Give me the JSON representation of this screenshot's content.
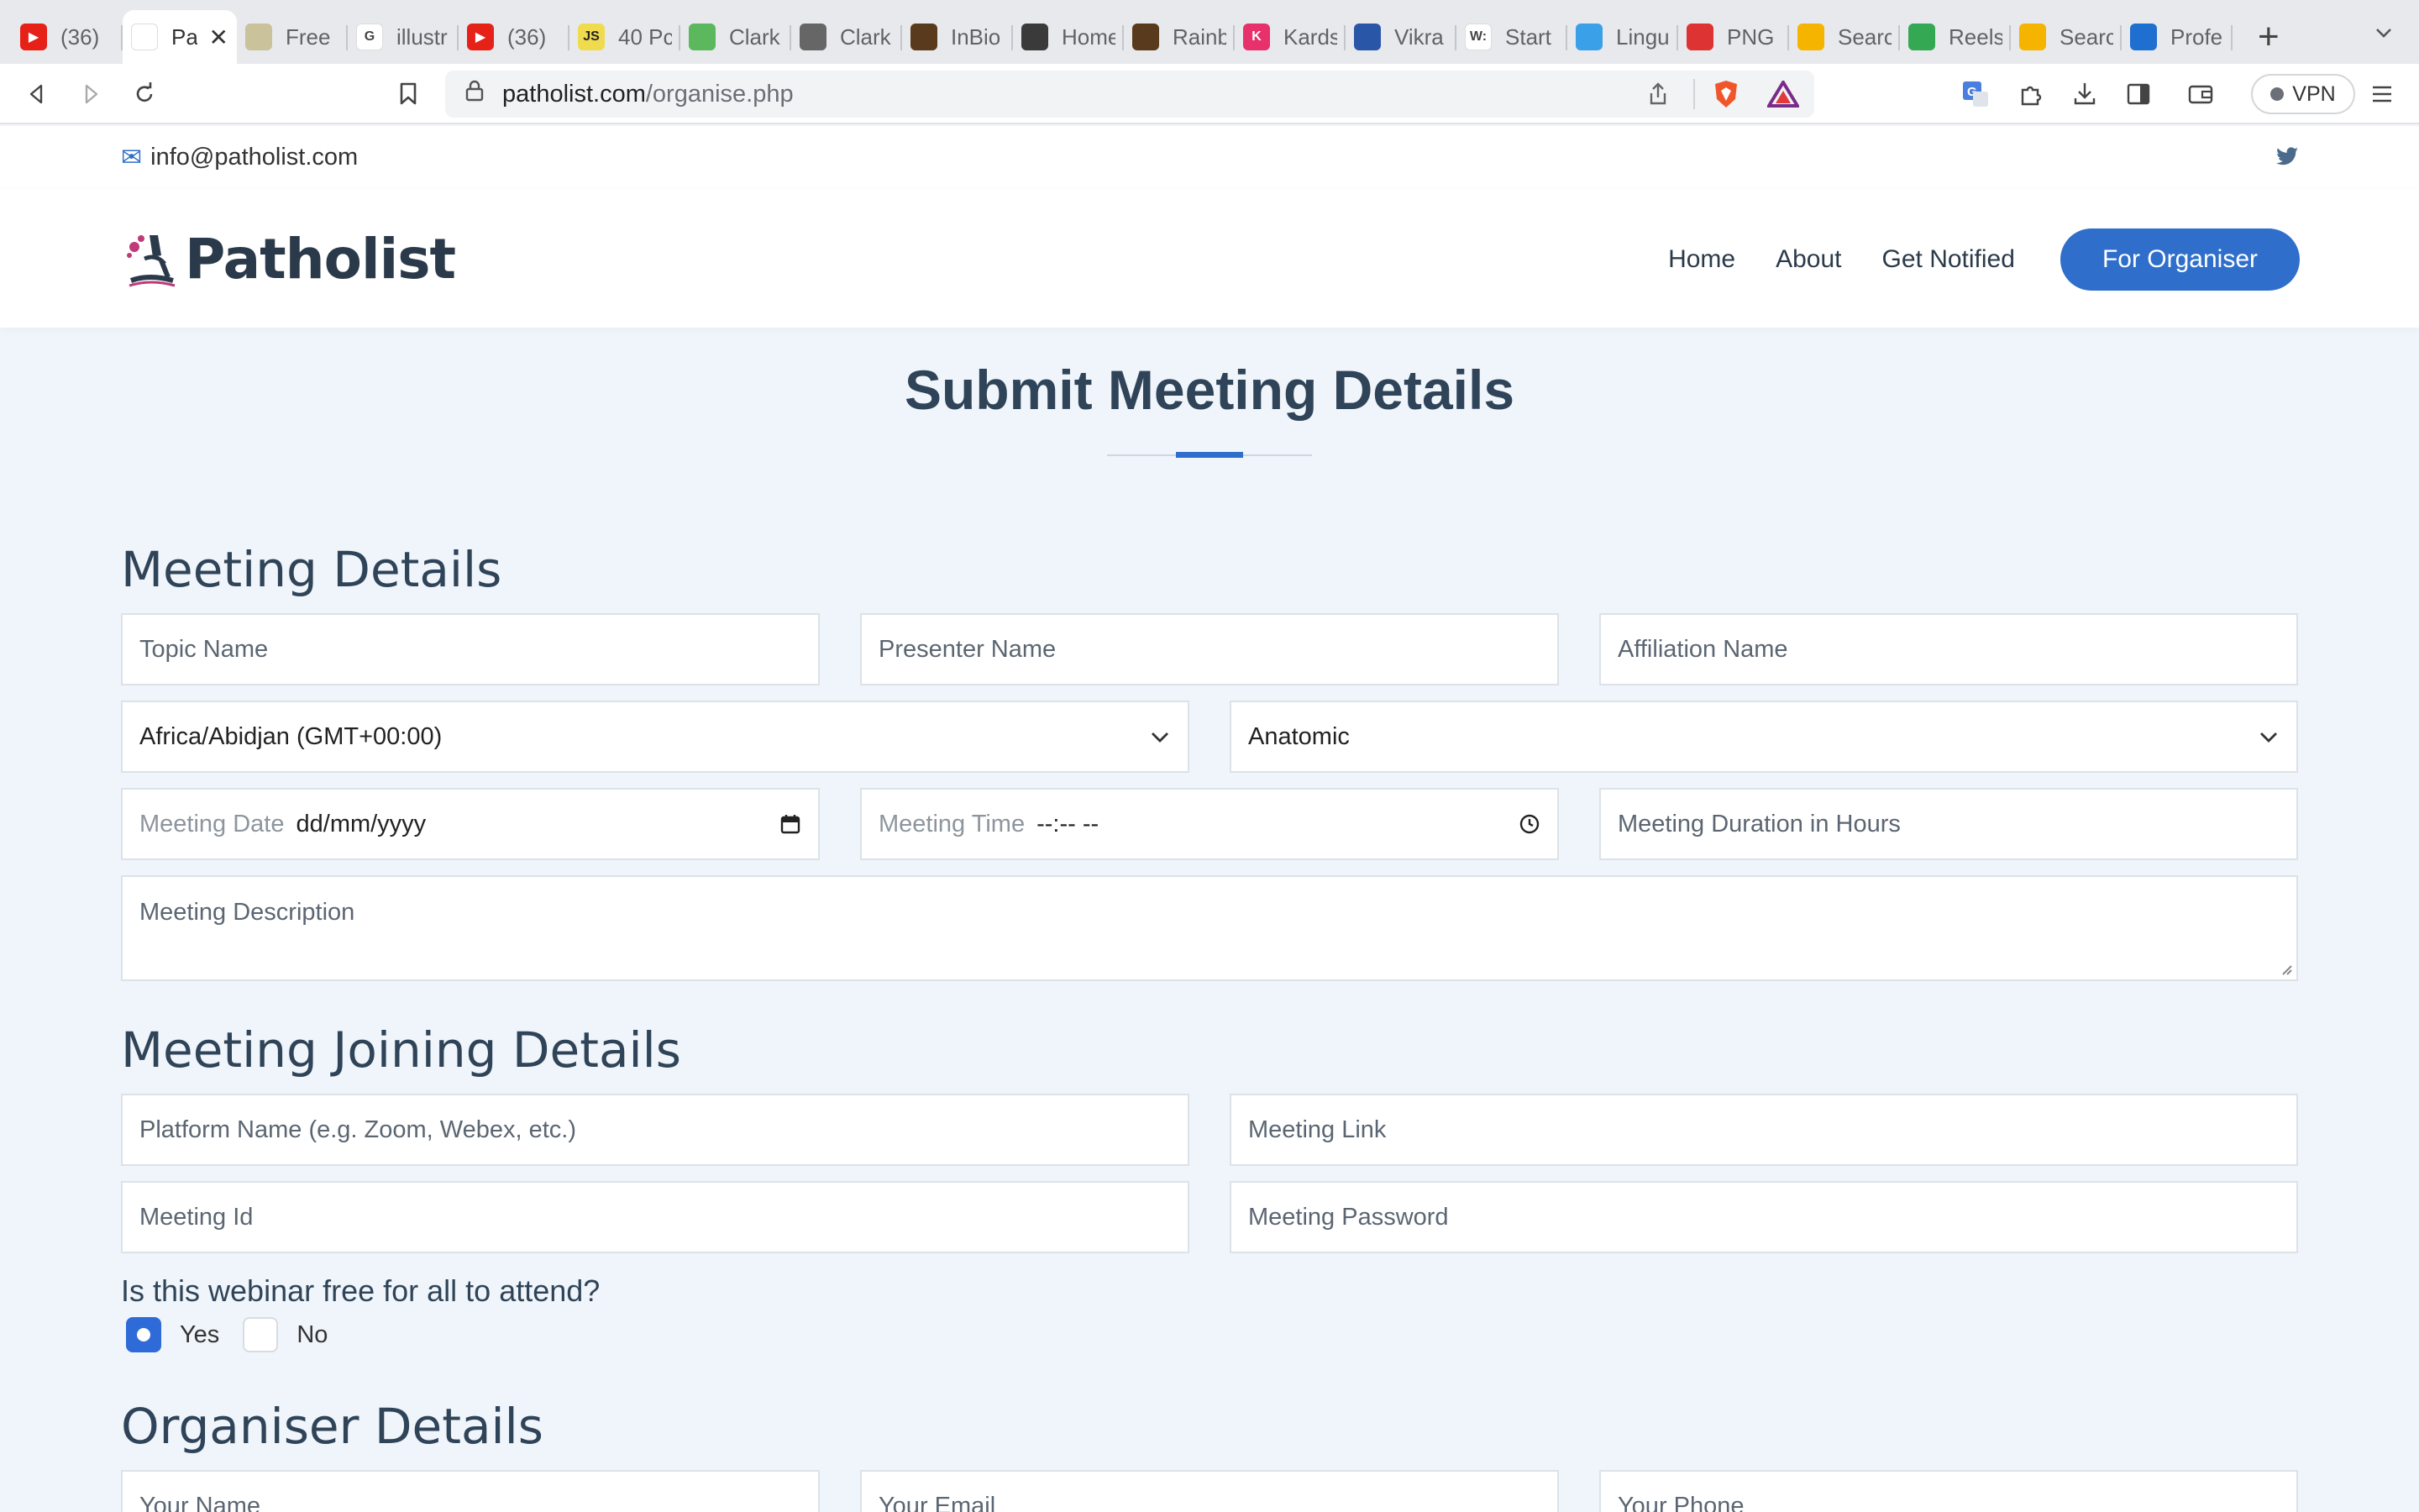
{
  "browser": {
    "tabs": [
      {
        "label": "(36)",
        "icon": "youtube-icon",
        "color": "#e62117",
        "glyph": "▶"
      },
      {
        "label": "Pa",
        "icon": "patholist-favicon-icon",
        "color": "#ffffff",
        "glyph": "",
        "active": true
      },
      {
        "label": "Free",
        "icon": "image-icon",
        "color": "#c9c29a",
        "glyph": ""
      },
      {
        "label": "illustr",
        "icon": "google-icon",
        "color": "#ffffff",
        "glyph": "G"
      },
      {
        "label": "(36)",
        "icon": "youtube-icon",
        "color": "#e62117",
        "glyph": "▶"
      },
      {
        "label": "40 Pc",
        "icon": "js-icon",
        "color": "#f0db4f",
        "glyph": "JS"
      },
      {
        "label": "Clark",
        "icon": "leaf-icon",
        "color": "#5cb85c",
        "glyph": ""
      },
      {
        "label": "Clark",
        "icon": "globe-icon",
        "color": "#666666",
        "glyph": ""
      },
      {
        "label": "InBio",
        "icon": "photo-icon",
        "color": "#5a3a1c",
        "glyph": ""
      },
      {
        "label": "Home",
        "icon": "avatar-icon",
        "color": "#3a3a3a",
        "glyph": ""
      },
      {
        "label": "Rainb",
        "icon": "photo-icon",
        "color": "#5a3a1c",
        "glyph": ""
      },
      {
        "label": "Kards",
        "icon": "k-icon",
        "color": "#e6316a",
        "glyph": "K"
      },
      {
        "label": "Vikra",
        "icon": "person-icon",
        "color": "#2a56a8",
        "glyph": ""
      },
      {
        "label": "Start",
        "icon": "w-icon",
        "color": "#ffffff",
        "glyph": "W:"
      },
      {
        "label": "Lingu",
        "icon": "bird-icon",
        "color": "#3aa0e8",
        "glyph": ""
      },
      {
        "label": "PNG",
        "icon": "cloud-icon",
        "color": "#d33",
        "glyph": ""
      },
      {
        "label": "Searc",
        "icon": "drive-icon",
        "color": "#f4b400",
        "glyph": ""
      },
      {
        "label": "Reels",
        "icon": "play-store-icon",
        "color": "#34a853",
        "glyph": ""
      },
      {
        "label": "Searc",
        "icon": "drive-icon",
        "color": "#f4b400",
        "glyph": ""
      },
      {
        "label": "Profe",
        "icon": "profile-icon",
        "color": "#1e6fd0",
        "glyph": ""
      }
    ],
    "url_host": "patholist.com",
    "url_path": "/organise.php",
    "vpn_label": "VPN"
  },
  "topinfo": {
    "email": "info@patholist.com"
  },
  "header": {
    "logo_text": "Patholist",
    "nav": [
      "Home",
      "About",
      "Get Notified"
    ],
    "cta": "For Organiser"
  },
  "page": {
    "title": "Submit Meeting Details"
  },
  "meeting_details": {
    "heading": "Meeting Details",
    "topic_placeholder": "Topic Name",
    "presenter_placeholder": "Presenter Name",
    "affiliation_placeholder": "Affiliation Name",
    "timezone_value": "Africa/Abidjan (GMT+00:00)",
    "category_value": "Anatomic",
    "date_label": "Meeting Date",
    "date_value": "dd/mm/yyyy",
    "time_label": "Meeting Time",
    "time_value": "--:-- --",
    "duration_placeholder": "Meeting Duration in Hours",
    "description_placeholder": "Meeting Description"
  },
  "joining": {
    "heading": "Meeting Joining Details",
    "platform_placeholder": "Platform Name (e.g. Zoom, Webex, etc.)",
    "link_placeholder": "Meeting Link",
    "id_placeholder": "Meeting Id",
    "password_placeholder": "Meeting Password",
    "free_question": "Is this webinar free for all to attend?",
    "yes_label": "Yes",
    "no_label": "No",
    "free_selected": "Yes"
  },
  "organiser": {
    "heading": "Organiser Details",
    "name_placeholder": "Your Name",
    "email_placeholder": "Your Email",
    "phone_placeholder": "Your Phone"
  },
  "colors": {
    "accent": "#2f6fcb",
    "heading": "#2f4458",
    "page_bg": "#f0f5fb"
  }
}
